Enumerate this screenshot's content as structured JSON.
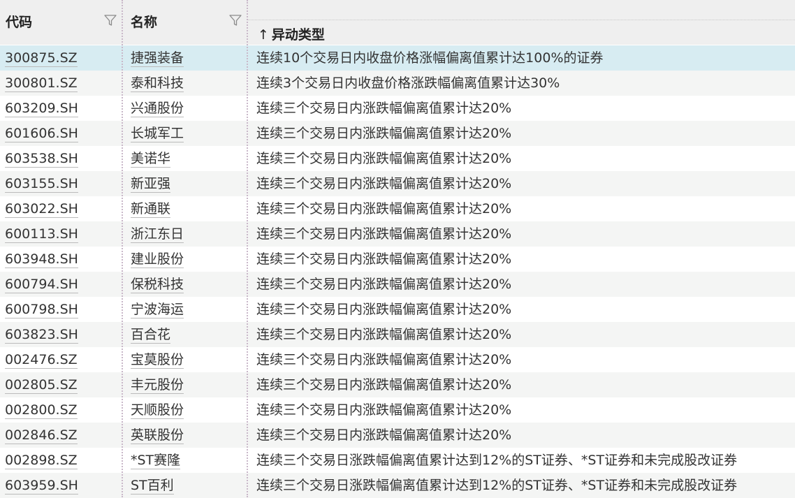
{
  "header": {
    "code_label": "代码",
    "name_label": "名称",
    "type_label": "异动类型",
    "sort_arrow": "↑"
  },
  "rows": [
    {
      "code": "300875.SZ",
      "name": "捷强装备",
      "type": "连续10个交易日内收盘价格涨幅偏离值累计达100%的证券"
    },
    {
      "code": "300801.SZ",
      "name": "泰和科技",
      "type": "连续3个交易日内收盘价格涨跌幅偏离值累计达30%"
    },
    {
      "code": "603209.SH",
      "name": "兴通股份",
      "type": "连续三个交易日内涨跌幅偏离值累计达20%"
    },
    {
      "code": "601606.SH",
      "name": "长城军工",
      "type": "连续三个交易日内涨跌幅偏离值累计达20%"
    },
    {
      "code": "603538.SH",
      "name": "美诺华",
      "type": "连续三个交易日内涨跌幅偏离值累计达20%"
    },
    {
      "code": "603155.SH",
      "name": "新亚强",
      "type": "连续三个交易日内涨跌幅偏离值累计达20%"
    },
    {
      "code": "603022.SH",
      "name": "新通联",
      "type": "连续三个交易日内涨跌幅偏离值累计达20%"
    },
    {
      "code": "600113.SH",
      "name": "浙江东日",
      "type": "连续三个交易日内涨跌幅偏离值累计达20%"
    },
    {
      "code": "603948.SH",
      "name": "建业股份",
      "type": "连续三个交易日内涨跌幅偏离值累计达20%"
    },
    {
      "code": "600794.SH",
      "name": "保税科技",
      "type": "连续三个交易日内涨跌幅偏离值累计达20%"
    },
    {
      "code": "600798.SH",
      "name": "宁波海运",
      "type": "连续三个交易日内涨跌幅偏离值累计达20%"
    },
    {
      "code": "603823.SH",
      "name": "百合花",
      "type": "连续三个交易日内涨跌幅偏离值累计达20%"
    },
    {
      "code": "002476.SZ",
      "name": "宝莫股份",
      "type": "连续三个交易日内涨跌幅偏离值累计达20%"
    },
    {
      "code": "002805.SZ",
      "name": "丰元股份",
      "type": "连续三个交易日内涨跌幅偏离值累计达20%"
    },
    {
      "code": "002800.SZ",
      "name": "天顺股份",
      "type": "连续三个交易日内涨跌幅偏离值累计达20%"
    },
    {
      "code": "002846.SZ",
      "name": "英联股份",
      "type": "连续三个交易日内涨跌幅偏离值累计达20%"
    },
    {
      "code": "002898.SZ",
      "name": "*ST赛隆",
      "type": "连续三个交易日涨跌幅偏离值累计达到12%的ST证券、*ST证券和未完成股改证券"
    },
    {
      "code": "603959.SH",
      "name": "ST百利",
      "type": "连续三个交易日涨跌幅偏离值累计达到12%的ST证券、*ST证券和未完成股改证券"
    }
  ],
  "selected_row": 0
}
